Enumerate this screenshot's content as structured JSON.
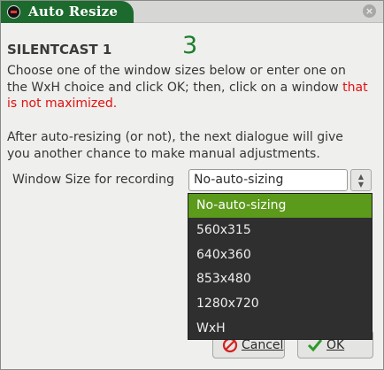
{
  "window": {
    "title": "Auto Resize",
    "close_glyph": "×"
  },
  "dialog": {
    "heading": "SILENTCAST 1",
    "countdown": "3",
    "message_line1": "Choose one of the window sizes below or enter one on",
    "message_line2": "the WxH choice and click OK; then, click on a window",
    "message_warn_part": "that",
    "message_line3_warn": "is not maximized.",
    "message2_line1": "After auto-resizing (or not), the next dialogue will give",
    "message2_line2": "you another chance to make manual adjustments.",
    "size_label": "Window Size for recording",
    "size_value": "No-auto-sizing",
    "size_options": [
      "No-auto-sizing",
      "560x315",
      "640x360",
      "853x480",
      "1280x720",
      "WxH"
    ],
    "selected_option_index": 0
  },
  "buttons": {
    "cancel_label": "Cancel",
    "ok_label": "OK"
  },
  "colors": {
    "title_tab": "#1c6a2e",
    "countdown": "#1a7e2c",
    "warning_text": "#e01010",
    "dropdown_bg": "#2f2f2f",
    "dropdown_selected": "#5c9a1b"
  },
  "icons": {
    "app_icon": "app-icon",
    "close_icon": "close-icon",
    "cancel_icon": "cancel-icon",
    "ok_icon": "checkmark-icon",
    "spin_icon": "spin-arrows-icon"
  }
}
